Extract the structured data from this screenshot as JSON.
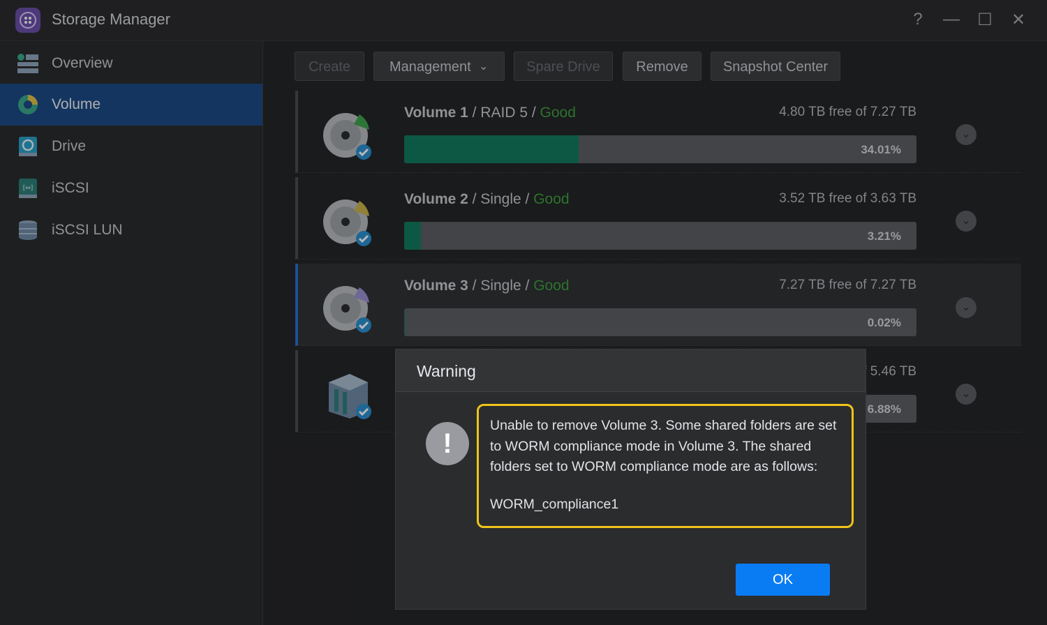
{
  "window": {
    "title": "Storage Manager",
    "controls": {
      "help": "?",
      "minimize": "—",
      "maximize": "☐",
      "close": "✕"
    }
  },
  "sidebar": {
    "items": [
      {
        "label": "Overview",
        "icon": "overview-icon"
      },
      {
        "label": "Volume",
        "icon": "volume-icon",
        "active": true
      },
      {
        "label": "Drive",
        "icon": "drive-icon"
      },
      {
        "label": "iSCSI",
        "icon": "iscsi-icon"
      },
      {
        "label": "iSCSI LUN",
        "icon": "iscsi-lun-icon"
      }
    ]
  },
  "toolbar": {
    "create": "Create",
    "management": "Management",
    "spare_drive": "Spare Drive",
    "remove": "Remove",
    "snapshot_center": "Snapshot Center"
  },
  "volumes": [
    {
      "name": "Volume 1",
      "type": " / RAID 5 / ",
      "status": "Good",
      "free": "4.80 TB free of 7.27 TB",
      "usage": 34.01,
      "usage_label": "34.01%",
      "accent": "#3fa34d"
    },
    {
      "name": "Volume 2",
      "type": " / Single / ",
      "status": "Good",
      "free": "3.52 TB free of 3.63 TB",
      "usage": 3.21,
      "usage_label": "3.21%",
      "accent": "#c9b24a"
    },
    {
      "name": "Volume 3",
      "type": " / Single / ",
      "status": "Good",
      "free": "7.27 TB free of 7.27 TB",
      "usage": 0.02,
      "usage_label": "0.02%",
      "accent": "#9a8fd0"
    },
    {
      "name": "",
      "type": "",
      "status": "",
      "free": "f 5.46 TB",
      "usage": 6.88,
      "usage_label": "6.88%",
      "accent": "#3fa34d"
    }
  ],
  "dialog": {
    "title": "Warning",
    "message": "Unable to remove Volume 3. Some shared folders are set to WORM compliance mode in Volume 3. The shared folders set to WORM compliance mode are as follows:",
    "folder": "WORM_compliance1",
    "ok": "OK"
  },
  "colors": {
    "accent_blue": "#0a7cf3",
    "selected_nav": "#1d4a86",
    "status_good": "#3f9f3f",
    "usage_fill": "#137a5f",
    "highlight_border": "#f0c419"
  }
}
